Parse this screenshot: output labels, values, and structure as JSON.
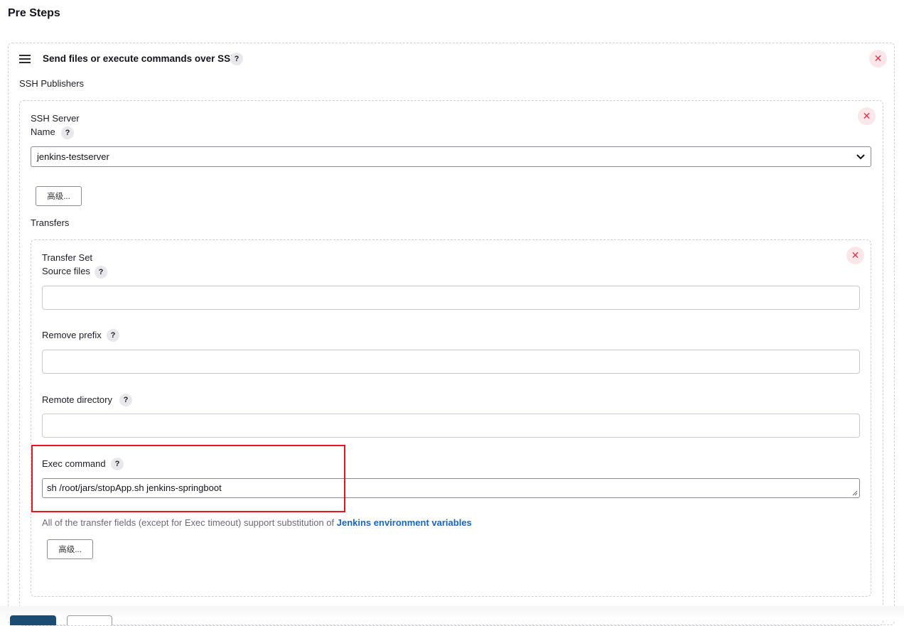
{
  "section_title": "Pre Steps",
  "step": {
    "title": "Send files or execute commands over SSH",
    "publishers_label": "SSH Publishers",
    "server": {
      "heading": "SSH Server",
      "name_label": "Name",
      "selected_name": "jenkins-testserver",
      "advanced_label": "高级..."
    },
    "transfers_label": "Transfers",
    "transfer_set": {
      "heading": "Transfer Set",
      "source_files_label": "Source files",
      "source_files_value": "",
      "remove_prefix_label": "Remove prefix",
      "remove_prefix_value": "",
      "remote_directory_label": "Remote directory",
      "remote_directory_value": "",
      "exec_command_label": "Exec command",
      "exec_command_value": "sh /root/jars/stopApp.sh jenkins-springboot",
      "hint_text": "All of the transfer fields (except for Exec timeout) support substitution of ",
      "hint_link": "Jenkins environment variables",
      "advanced_label": "高级..."
    }
  },
  "icons": {
    "help": "?",
    "delete": "✕",
    "chevron": "chevron-down-icon",
    "drag": "drag-handle-icon"
  },
  "colors": {
    "highlight": "#e8141d",
    "link": "#1966c0",
    "delete": "#d23a4b",
    "primary_button": "#1d4c73"
  }
}
